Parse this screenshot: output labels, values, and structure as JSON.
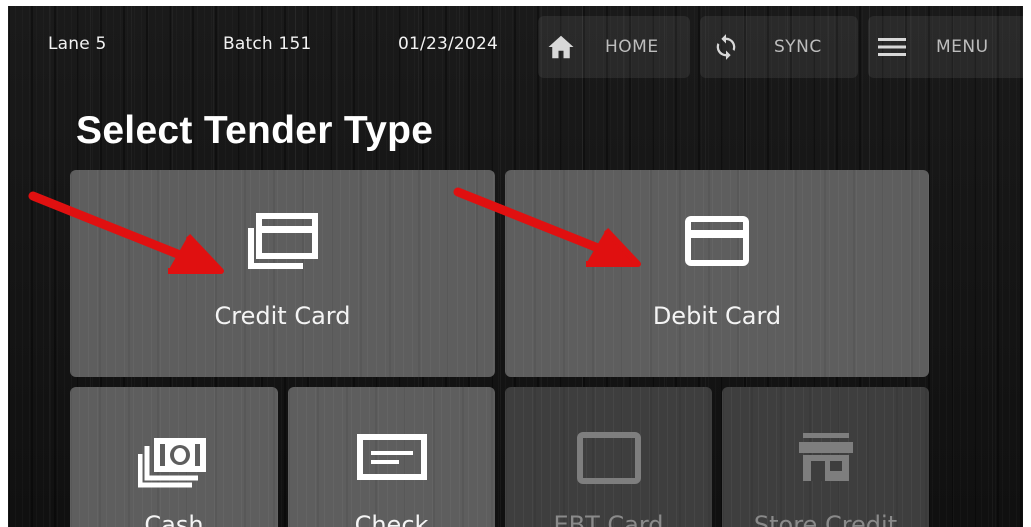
{
  "header": {
    "lane": "Lane 5",
    "batch": "Batch 151",
    "date": "01/23/2024",
    "home_label": "HOME",
    "sync_label": "SYNC",
    "menu_label": "MENU"
  },
  "page_title": "Select Tender Type",
  "tenders": {
    "credit": {
      "label": "Credit Card",
      "icon": "credit-card-stack-icon"
    },
    "debit": {
      "label": "Debit Card",
      "icon": "debit-card-icon"
    },
    "cash": {
      "label": "Cash",
      "icon": "cash-icon"
    },
    "check": {
      "label": "Check",
      "icon": "check-icon"
    },
    "ebt": {
      "label": "EBT Card",
      "icon": "ebt-card-icon"
    },
    "store_credit": {
      "label": "Store Credit",
      "icon": "store-icon"
    }
  },
  "colors": {
    "annotation_arrow": "#e01010",
    "tile_enabled": "#5e5e5e",
    "tile_disabled": "#3e3e3e"
  }
}
